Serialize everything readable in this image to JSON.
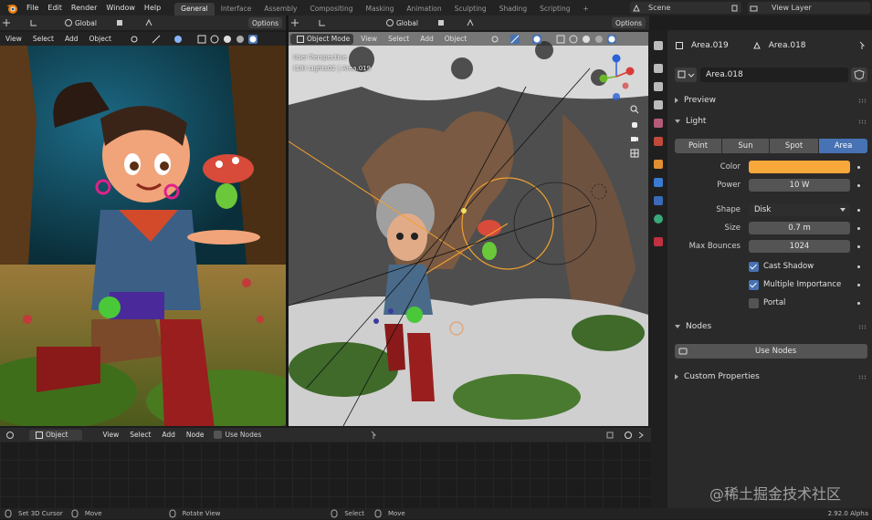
{
  "menu": [
    "File",
    "Edit",
    "Render",
    "Window",
    "Help"
  ],
  "workspace_tabs": [
    {
      "label": "General",
      "active": true
    },
    {
      "label": "Interface",
      "active": false
    },
    {
      "label": "Assembly",
      "active": false
    },
    {
      "label": "Compositing",
      "active": false
    },
    {
      "label": "Masking",
      "active": false
    },
    {
      "label": "Animation",
      "active": false
    },
    {
      "label": "Sculpting",
      "active": false
    },
    {
      "label": "Shading",
      "active": false
    },
    {
      "label": "Scripting",
      "active": false
    }
  ],
  "add_tab_symbol": "+",
  "scene": {
    "label": "Scene"
  },
  "view_layer": {
    "label": "View Layer"
  },
  "left_viewport": {
    "orientation": "Global",
    "options_label": "Options",
    "menus": [
      "View",
      "Select",
      "Add",
      "Object"
    ]
  },
  "right_viewport": {
    "orientation": "Global",
    "options_label": "Options",
    "mode": "Object Mode",
    "menus": [
      "View",
      "Select",
      "Add",
      "Object"
    ],
    "overlay_line1": "User Perspective",
    "overlay_line2": "(18) Lights02 | Area.019"
  },
  "properties": {
    "object_name": "Area.019",
    "data_name_header": "Area.018",
    "data_name": "Area.018",
    "sections": {
      "preview": "Preview",
      "light": "Light",
      "nodes": "Nodes",
      "custom": "Custom Properties"
    },
    "light_types": [
      {
        "label": "Point",
        "active": false
      },
      {
        "label": "Sun",
        "active": false
      },
      {
        "label": "Spot",
        "active": false
      },
      {
        "label": "Area",
        "active": true
      }
    ],
    "color_label": "Color",
    "color_value": "#f8a73a",
    "power_label": "Power",
    "power_value": "10 W",
    "shape_label": "Shape",
    "shape_value": "Disk",
    "size_label": "Size",
    "size_value": "0.7 m",
    "bounces_label": "Max Bounces",
    "bounces_value": "1024",
    "cast_shadow": {
      "label": "Cast Shadow",
      "checked": true
    },
    "multiple_importance": {
      "label": "Multiple Importance",
      "checked": true
    },
    "portal": {
      "label": "Portal",
      "checked": false
    },
    "use_nodes_label": "Use Nodes"
  },
  "node_editor": {
    "mode": "Object",
    "menus": [
      "View",
      "Select",
      "Add",
      "Node"
    ],
    "use_nodes_label": "Use Nodes"
  },
  "status": {
    "left": "Set 3D Cursor",
    "move1": "Move",
    "rotate": "Rotate View",
    "select": "Select",
    "move2": "Move",
    "version": "2.92.0 Alpha"
  },
  "watermark": "@稀土掘金技术社区",
  "accent_color": "#4772b3"
}
